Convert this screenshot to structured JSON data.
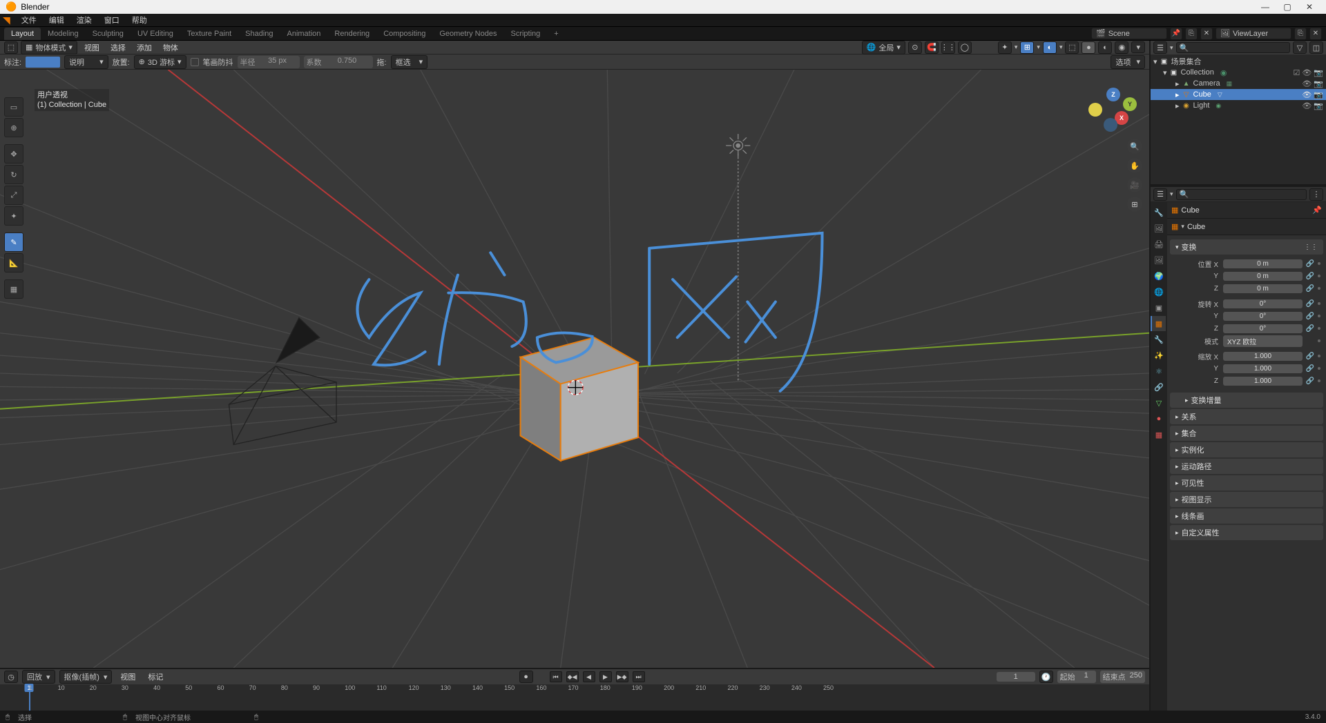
{
  "app_title": "Blender",
  "menus": [
    "文件",
    "编辑",
    "渲染",
    "窗口",
    "帮助"
  ],
  "workspaces": [
    "Layout",
    "Modeling",
    "Sculpting",
    "UV Editing",
    "Texture Paint",
    "Shading",
    "Animation",
    "Rendering",
    "Compositing",
    "Geometry Nodes",
    "Scripting"
  ],
  "workspace_add": "+",
  "scene_label": "Scene",
  "viewlayer_label": "ViewLayer",
  "viewport_header": {
    "mode": "物体模式",
    "menu": [
      "视图",
      "选择",
      "添加",
      "物体"
    ],
    "global": "全局",
    "options": "选项"
  },
  "anno_bar": {
    "label": "标注:",
    "note": "说明",
    "placement_lbl": "放置:",
    "placement_val": "3D 游标",
    "stabilize": "笔画防抖",
    "radius_lbl": "半径",
    "radius_val": "35 px",
    "factor_lbl": "系数",
    "factor_val": "0.750",
    "drag": "拖:",
    "box": "框选"
  },
  "view_info_line1": "用户透视",
  "view_info_line2": "(1) Collection | Cube",
  "axes": {
    "x": "X",
    "y": "Y",
    "z": "Z"
  },
  "timeline": {
    "playback": "回放",
    "keying": "抠像(插帧)",
    "menu": [
      "视图",
      "标记"
    ],
    "current": 1,
    "start_lbl": "起始",
    "start": 1,
    "end_lbl": "结束点",
    "end": 250,
    "ticks": [
      1,
      10,
      20,
      30,
      40,
      50,
      60,
      70,
      80,
      90,
      100,
      110,
      120,
      130,
      140,
      150,
      160,
      170,
      180,
      190,
      200,
      210,
      220,
      230,
      240,
      250
    ]
  },
  "outliner": {
    "root": "场景集合",
    "coll": "Collection",
    "items": [
      {
        "name": "Camera",
        "icon": "📷"
      },
      {
        "name": "Cube",
        "icon": "▣",
        "sel": true
      },
      {
        "name": "Light",
        "icon": "◉"
      }
    ]
  },
  "props": {
    "obj_name": "Cube",
    "data_name": "Cube",
    "transform": "变换",
    "loc_lbl": "位置 X",
    "loc": [
      "0 m",
      "0 m",
      "0 m"
    ],
    "rot_lbl": "旋转 X",
    "rot": [
      "0°",
      "0°",
      "0°"
    ],
    "mode_lbl": "模式",
    "mode_val": "XYZ 欧拉",
    "scl_lbl": "缩放 X",
    "scl": [
      "1.000",
      "1.000",
      "1.000"
    ],
    "yz": [
      "Y",
      "Z"
    ],
    "panels": [
      "变换增量",
      "关系",
      "集合",
      "实例化",
      "运动路径",
      "可见性",
      "视图显示",
      "线条画",
      "自定义属性"
    ]
  },
  "status": {
    "select": "选择",
    "center": "视图中心对齐鼠标",
    "version": "3.4.0"
  }
}
